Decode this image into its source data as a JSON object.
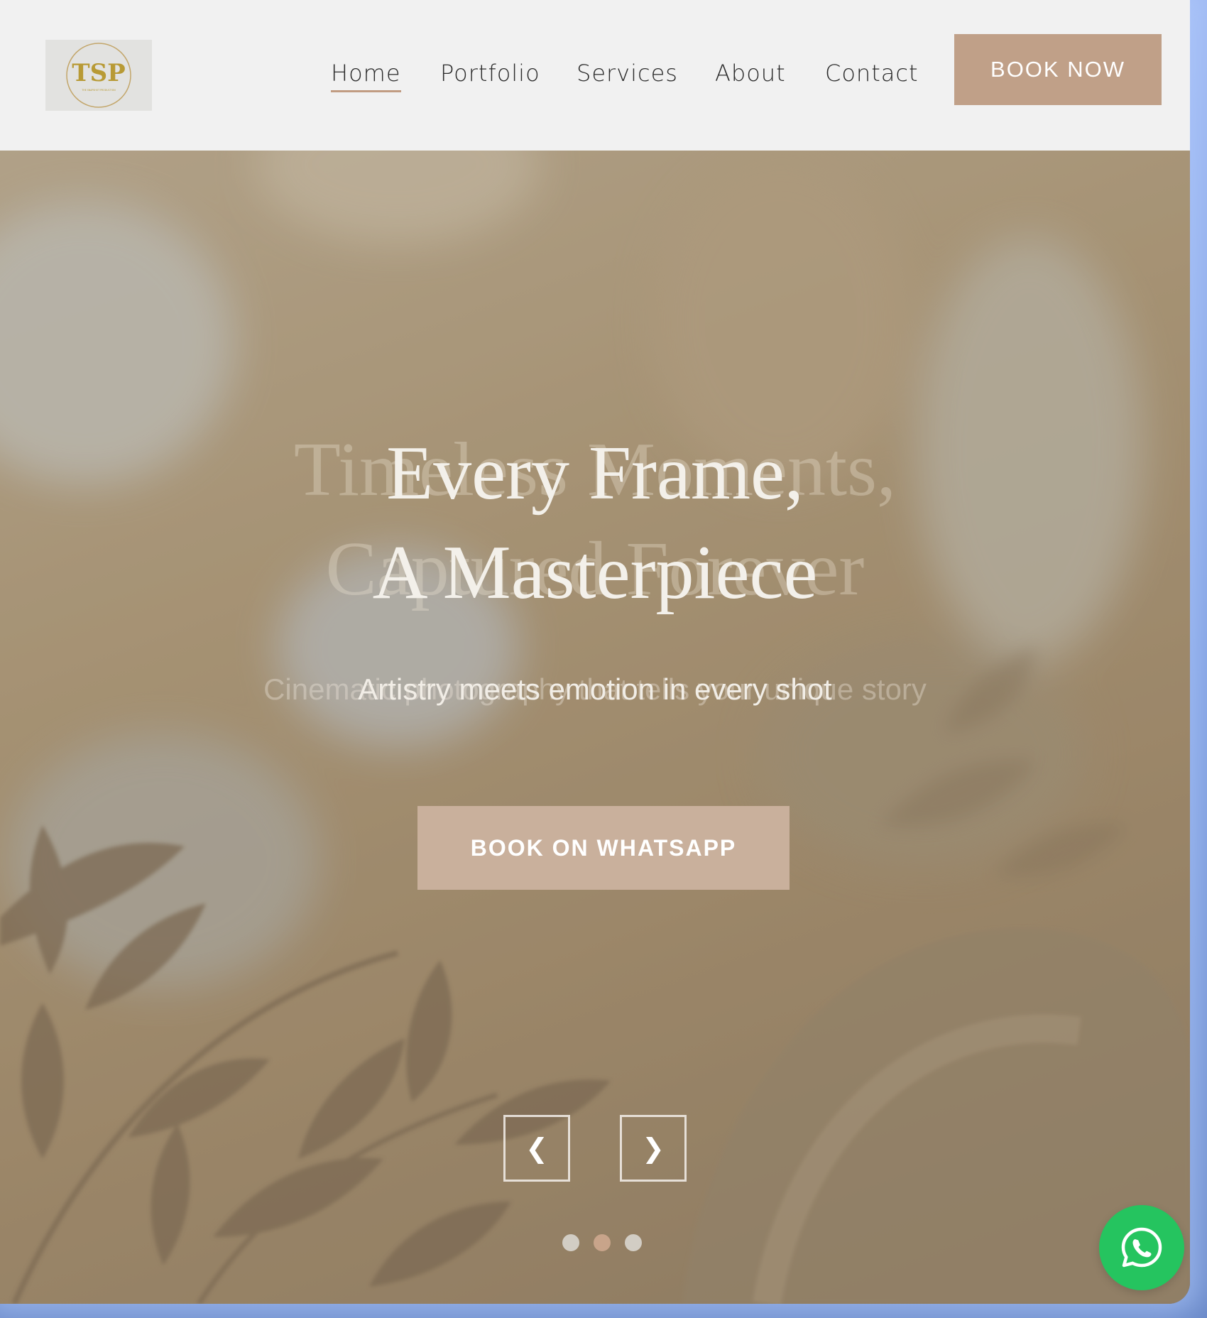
{
  "brand": {
    "logo_initials": "TSP",
    "logo_caption": "THE SNAPSHOT PRODUCTION",
    "logo_color": "#b89a35"
  },
  "nav": {
    "items": [
      {
        "label": "Home",
        "active": true
      },
      {
        "label": "Portfolio",
        "active": false
      },
      {
        "label": "Services",
        "active": false
      },
      {
        "label": "About",
        "active": false
      },
      {
        "label": "Contact",
        "active": false
      }
    ],
    "cta_label": "BOOK NOW"
  },
  "hero": {
    "ghost_headline_line1": "Timeless Moments,",
    "ghost_headline_line2": "Captured Forever",
    "headline_line1": "Every Frame,",
    "headline_line2": "A Masterpiece",
    "ghost_subtitle": "Cinematic photography that tells your unique story",
    "subtitle": "Artistry meets emotion in every shot",
    "cta_label": "BOOK ON WHATSAPP",
    "prev_arrow": "❮",
    "next_arrow": "❯",
    "slide_count": 3,
    "active_slide": 2
  },
  "icons": {
    "floating_button": "whatsapp-icon"
  },
  "colors": {
    "accent": "#c0a088",
    "whatsapp": "#25c45f"
  }
}
